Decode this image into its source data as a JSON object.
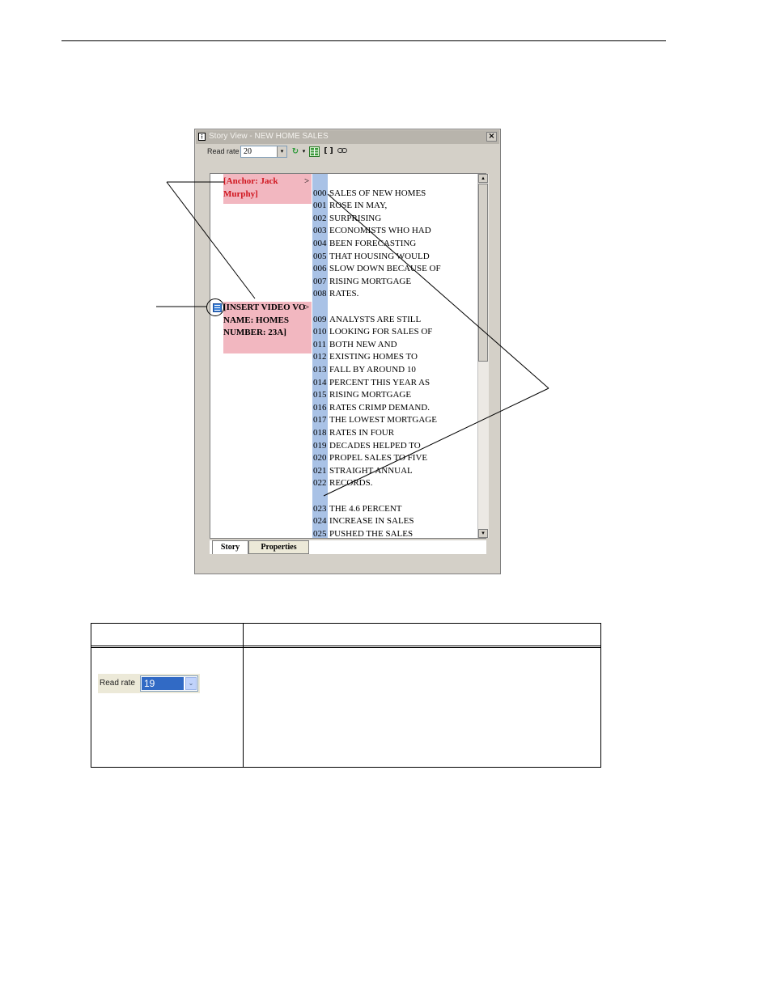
{
  "window": {
    "title": "Story View - NEW HOME SALES",
    "close_glyph": "×"
  },
  "toolbar": {
    "read_rate_label": "Read rate",
    "read_rate_value": "20",
    "dropdown_glyph": "▾",
    "refresh_icon": "refresh-icon",
    "grid_icon": "grid-icon",
    "bracket_label": "[ ]",
    "link_icon": "link-icon"
  },
  "story": {
    "cue1": "[Anchor: Jack Murphy]",
    "cue2": "[INSERT VIDEO VO NAME: HOMES NUMBER: 23A]",
    "cue_arrow": ">",
    "lines": [
      {
        "n": "000",
        "text": "SALES OF NEW HOMES"
      },
      {
        "n": "001",
        "text": "ROSE IN MAY,"
      },
      {
        "n": "002",
        "text": "SURPRISING"
      },
      {
        "n": "003",
        "text": "ECONOMISTS WHO HAD"
      },
      {
        "n": "004",
        "text": "BEEN FORECASTING"
      },
      {
        "n": "005",
        "text": "THAT HOUSING WOULD"
      },
      {
        "n": "006",
        "text": "SLOW DOWN BECAUSE OF"
      },
      {
        "n": "007",
        "text": "RISING MORTGAGE"
      },
      {
        "n": "008",
        "text": "RATES."
      },
      {
        "n": "009",
        "text": "ANALYSTS ARE STILL"
      },
      {
        "n": "010",
        "text": "LOOKING FOR SALES OF"
      },
      {
        "n": "011",
        "text": "BOTH NEW AND"
      },
      {
        "n": "012",
        "text": "EXISTING HOMES TO"
      },
      {
        "n": "013",
        "text": "FALL BY AROUND 10"
      },
      {
        "n": "014",
        "text": "PERCENT THIS YEAR AS"
      },
      {
        "n": "015",
        "text": "RISING MORTGAGE"
      },
      {
        "n": "016",
        "text": "RATES CRIMP DEMAND."
      },
      {
        "n": "017",
        "text": "THE LOWEST MORTGAGE"
      },
      {
        "n": "018",
        "text": "RATES IN FOUR"
      },
      {
        "n": "019",
        "text": "DECADES HELPED TO"
      },
      {
        "n": "020",
        "text": "PROPEL SALES TO FIVE"
      },
      {
        "n": "021",
        "text": "STRAIGHT ANNUAL"
      },
      {
        "n": "022",
        "text": "RECORDS."
      },
      {
        "n": "023",
        "text": "THE 4.6 PERCENT"
      },
      {
        "n": "024",
        "text": "INCREASE IN SALES"
      },
      {
        "n": "025",
        "text": "PUSHED THE SALES"
      }
    ]
  },
  "scrollbar": {
    "up_glyph": "▴",
    "down_glyph": "▾"
  },
  "tabs": [
    {
      "label": "Story",
      "active": true
    },
    {
      "label": "Properties",
      "active": false
    }
  ],
  "table": {
    "read_rate_label": "Read rate",
    "read_rate_value": "19",
    "dropdown_glyph": "⌄"
  }
}
